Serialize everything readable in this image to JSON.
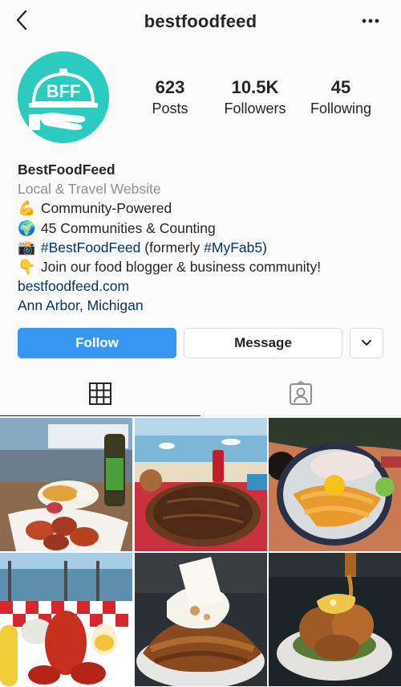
{
  "header": {
    "username": "bestfoodfeed"
  },
  "avatar": {
    "logo_text": "BFF",
    "brand_color": "#2ccbbf"
  },
  "stats": {
    "posts_count": "623",
    "posts_label": "Posts",
    "followers_count": "10.5K",
    "followers_label": "Followers",
    "following_count": "45",
    "following_label": "Following"
  },
  "bio": {
    "name": "BestFoodFeed",
    "category": "Local & Travel Website",
    "lines": [
      {
        "emoji": "💪",
        "text": "Community-Powered"
      },
      {
        "emoji": "🌍",
        "text": "45 Communities & Counting"
      },
      {
        "emoji": "📸",
        "hashtag1": "#BestFoodFeed",
        "middle": " (formerly ",
        "hashtag2": "#MyFab5",
        "end": ")"
      },
      {
        "emoji": "👇",
        "text": "Join our food blogger & business community!"
      }
    ],
    "website": "bestfoodfeed.com",
    "location": "Ann Arbor, Michigan"
  },
  "actions": {
    "follow_label": "Follow",
    "message_label": "Message"
  },
  "colors": {
    "follow_blue": "#3897f0",
    "link_color": "#00376b",
    "muted_text": "#8e8e8e"
  },
  "tabs": [
    {
      "name": "grid-icon"
    },
    {
      "name": "tagged-icon"
    }
  ],
  "grid_posts": [
    {
      "subject": "chicken wings and fries on a dock"
    },
    {
      "subject": "flatbread pizza on a beach table"
    },
    {
      "subject": "sea urchin and poke bowl with egg yolk"
    },
    {
      "subject": "lobster with corn on checkered paper"
    },
    {
      "subject": "croissant with whipped topping"
    },
    {
      "subject": "fried chicken with sauce poured"
    }
  ]
}
